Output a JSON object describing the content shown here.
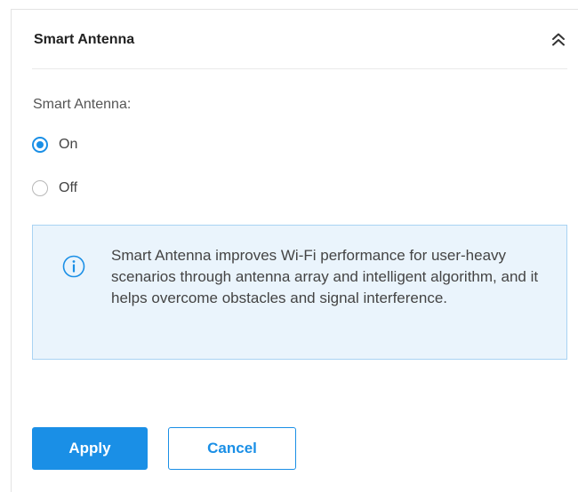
{
  "panel": {
    "title": "Smart Antenna",
    "collapse_icon": "double-chevron-up-icon"
  },
  "smart_antenna": {
    "label": "Smart Antenna:",
    "options": [
      {
        "label": "On",
        "selected": true
      },
      {
        "label": "Off",
        "selected": false
      }
    ]
  },
  "info": {
    "icon": "info-circle-icon",
    "text": "Smart Antenna improves Wi-Fi performance for user-heavy scenarios through antenna array and intelligent algorithm, and it helps overcome obstacles and signal interference."
  },
  "actions": {
    "apply_label": "Apply",
    "cancel_label": "Cancel"
  },
  "colors": {
    "accent": "#1a8fe6",
    "info_background": "#eaf4fc",
    "info_border": "#a9d3f3"
  }
}
